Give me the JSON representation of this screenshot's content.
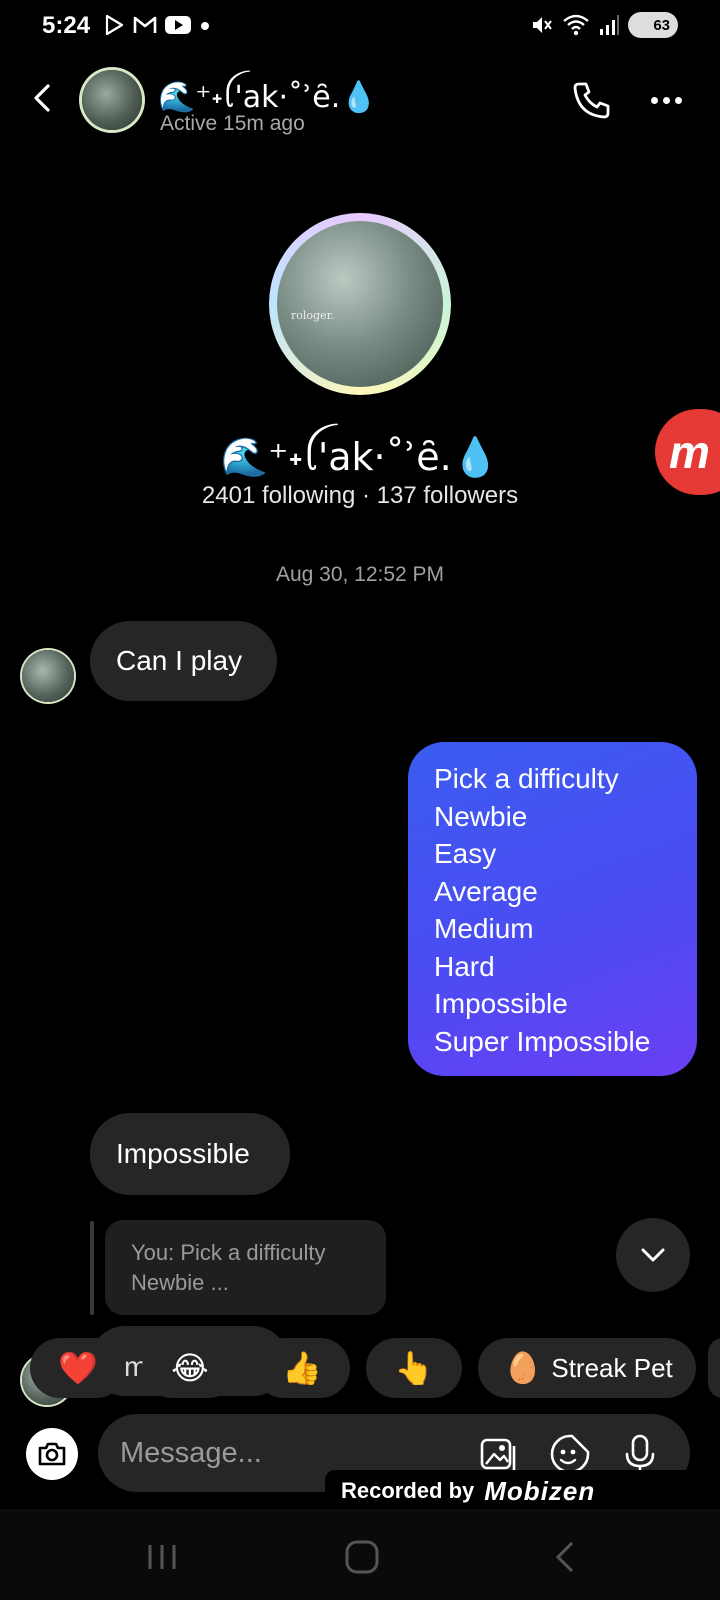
{
  "status_bar": {
    "time": "5:24",
    "battery": "63"
  },
  "header": {
    "name": "🌊⁺˖ꪶ'ak·˚ʾȇ.💧",
    "active_status": "Active 15m ago"
  },
  "profile": {
    "avatar_caption": "rologer.",
    "name": "🌊⁺˖ꪶ'ak·˚ʾȇ.💧",
    "stats": "2401 following · 137 followers"
  },
  "floating_button": {
    "label": "m"
  },
  "thread": {
    "timestamp": "Aug 30, 12:52 PM",
    "messages": [
      {
        "from": "them",
        "text": "Can I play"
      },
      {
        "from": "me",
        "lines": [
          "Pick a difficulty",
          "Newbie",
          "Easy",
          "Average",
          "Medium",
          "Hard",
          "Impossible",
          "Super Impossible"
        ]
      },
      {
        "from": "them",
        "text": "Impossible"
      }
    ],
    "reply_preview": {
      "line1": "You: Pick a difficulty",
      "line2": "Newbie ..."
    },
    "partial_bubble_text": "m          le"
  },
  "reactions": [
    {
      "emoji": "❤️"
    },
    {
      "emoji": "😂"
    },
    {
      "emoji": "👍"
    },
    {
      "emoji": "👆"
    }
  ],
  "streak_chip": {
    "emoji": "🥚",
    "label": "Streak Pet"
  },
  "composer": {
    "placeholder": "Message..."
  },
  "recorded_banner": {
    "text": "Recorded by",
    "logo": "Mobizen"
  }
}
